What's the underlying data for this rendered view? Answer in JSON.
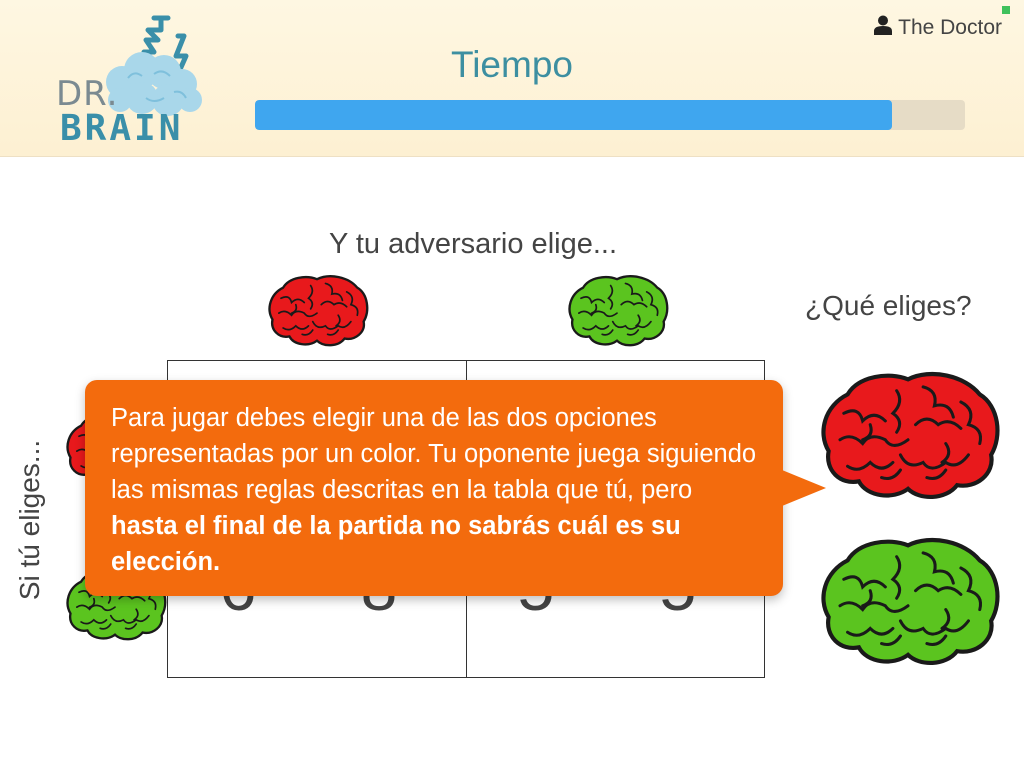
{
  "header": {
    "logo": {
      "line1": "DR.",
      "line2": "BRAIN"
    },
    "timer_label": "Tiempo",
    "timer_progress": 0.897,
    "user_name": "The Doctor"
  },
  "game": {
    "opponent_prompt": "Y tu adversario elige...",
    "player_prompt": "Si tú eliges...",
    "choose_prompt": "¿Qué eliges?",
    "table": {
      "rows": [
        {
          "row": "red",
          "cells": [
            [
              "",
              ""
            ],
            [
              "",
              ""
            ]
          ]
        },
        {
          "row": "green",
          "cells": [
            [
              "6",
              "8"
            ],
            [
              "5",
              "5"
            ]
          ]
        }
      ]
    }
  },
  "tooltip": {
    "text_plain": "Para jugar debes elegir una de las dos opciones representadas por un color. Tu oponente juega siguiendo las mismas reglas descritas en la tabla que tú, pero ",
    "text_bold": "hasta el final de la partida no sabrás cuál es su elección."
  },
  "colors": {
    "accent_blue": "#3fa6ef",
    "tooltip_orange": "#f36b0d",
    "brain_red": "#e8191c",
    "brain_green": "#5bc41f",
    "header_bg": "#fef7e2"
  },
  "icons": [
    "user-icon",
    "brain-red-icon",
    "brain-green-icon",
    "dr-brain-logo"
  ]
}
